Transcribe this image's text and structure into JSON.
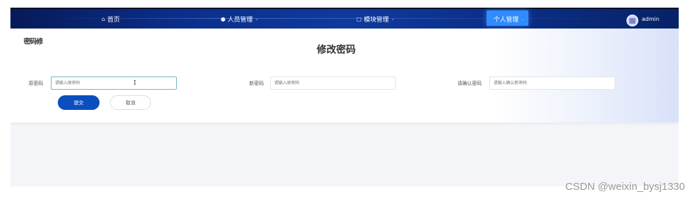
{
  "nav": {
    "items": [
      {
        "label": "首页",
        "icon": "home-icon",
        "has_dropdown": false
      },
      {
        "label": "人员管理",
        "icon": "user-icon",
        "has_dropdown": true
      },
      {
        "label": "模块管理",
        "icon": "module-icon",
        "has_dropdown": true
      },
      {
        "label": "个人管理",
        "icon": "",
        "has_dropdown": true,
        "active": true
      }
    ],
    "user": "admin",
    "chevron": "⌄"
  },
  "breadcrumb": "密码修",
  "page_title": "修改密码",
  "form": {
    "old_password": {
      "label": "原密码",
      "placeholder": "请输入原密码"
    },
    "new_password": {
      "label": "新密码",
      "placeholder": "请输入原密码"
    },
    "confirm_password": {
      "label": "请确认密码",
      "placeholder": "请输入确认新密码"
    },
    "submit_label": "提交",
    "cancel_label": "取消"
  },
  "watermark": "CSDN @weixin_bysj1330",
  "colors": {
    "nav_bg": "#0b2e8a",
    "nav_active": "#2f8cff",
    "primary_button": "#0a4fbd",
    "focus_border": "#72b7c7"
  }
}
